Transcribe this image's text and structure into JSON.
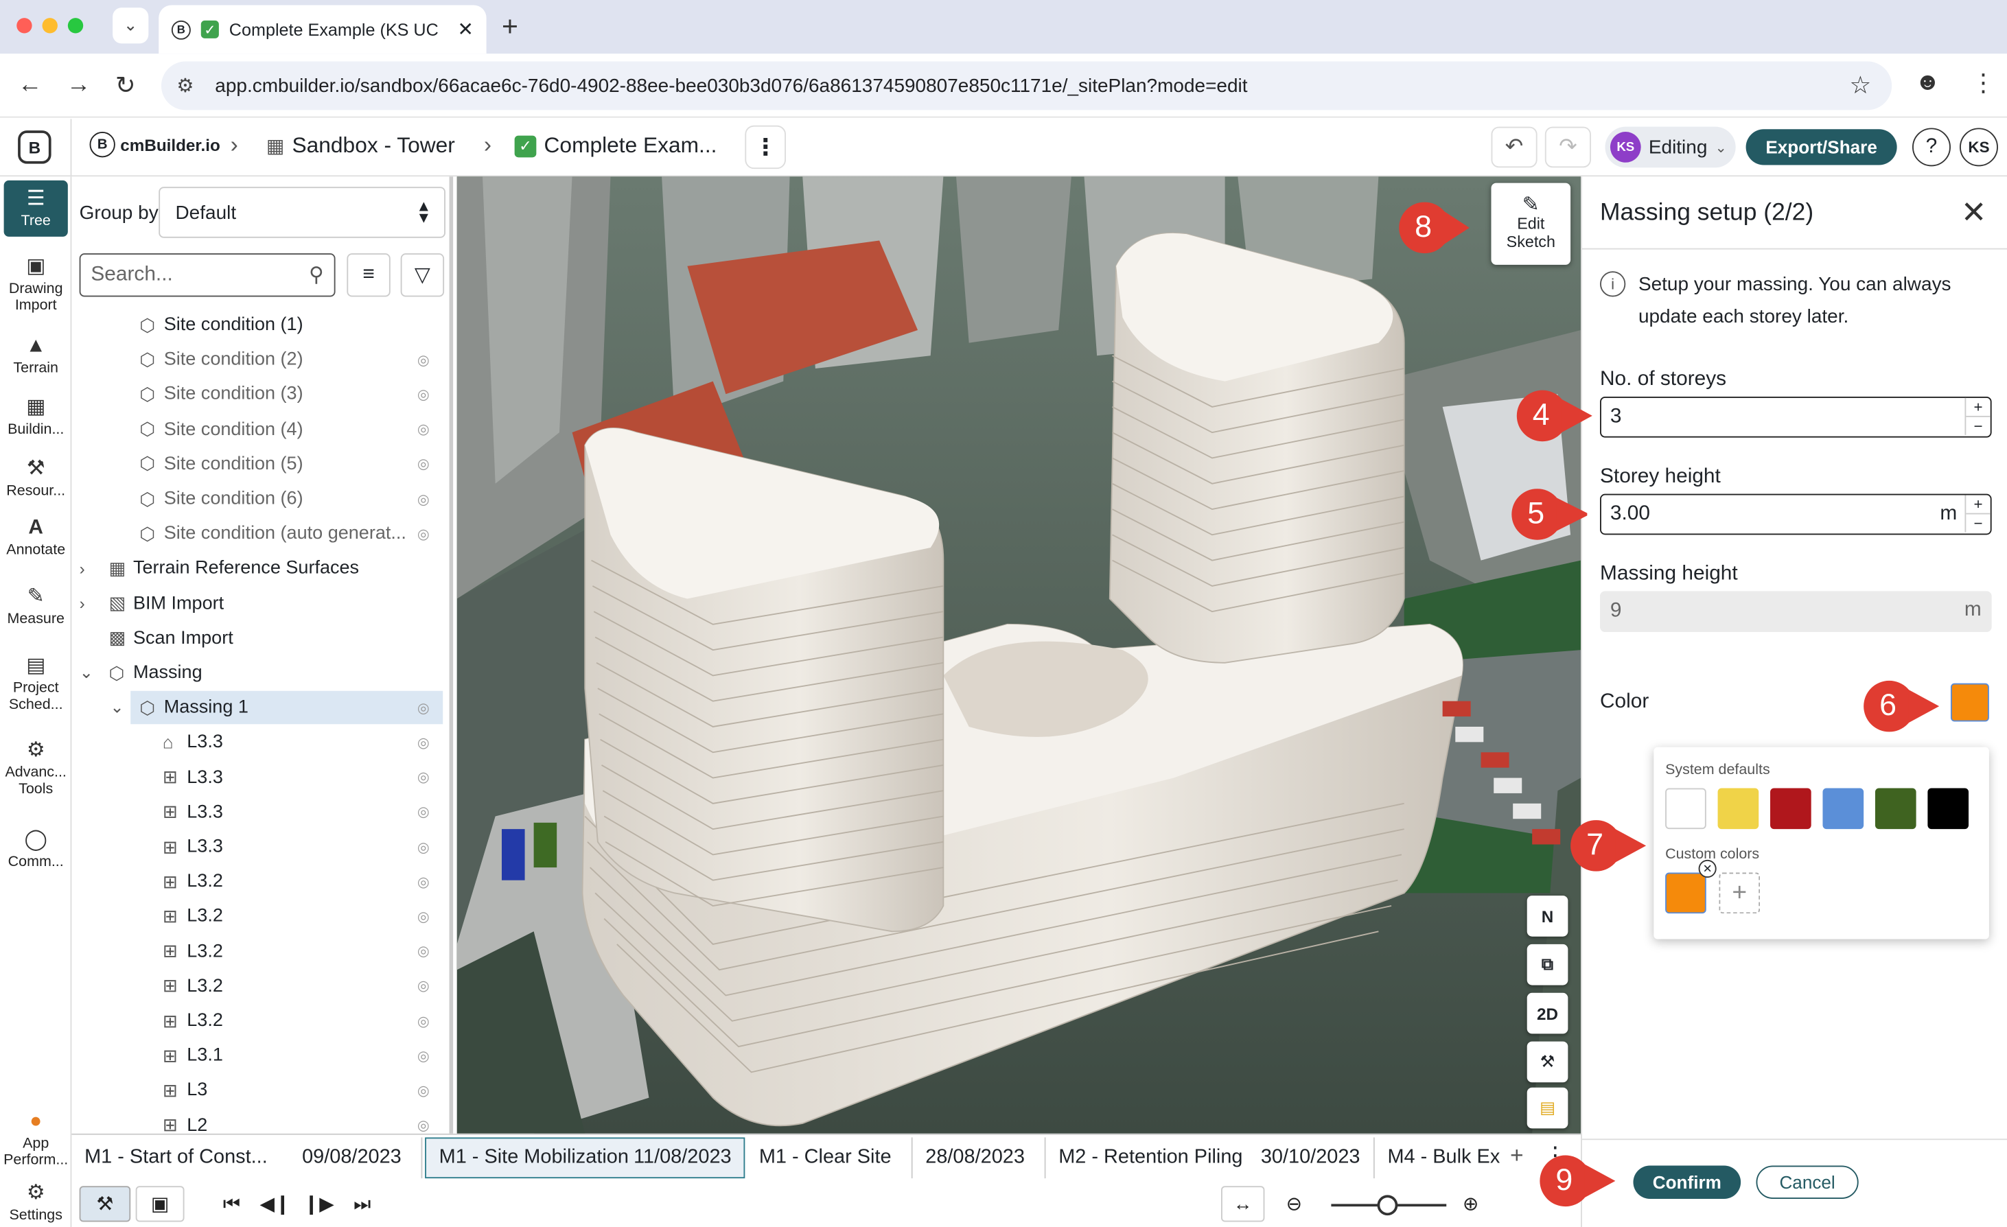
{
  "browser": {
    "tab_title": "Complete Example (KS UC",
    "url": "app.cmbuilder.io/sandbox/66acae6c-76d0-4902-88ee-bee030b3d076/6a861374590807e850c1171e/_sitePlan?mode=edit"
  },
  "header": {
    "brand": "cmBuilder.io",
    "crumb_project": "Sandbox - Tower",
    "crumb_file": "Complete Exam...",
    "status": "Editing",
    "user_initials": "KS",
    "export_label": "Export/Share",
    "help": "?"
  },
  "left_toolbar": [
    {
      "label": "Tree",
      "icon": "tree-icon",
      "active": true
    },
    {
      "label": "Drawing Import",
      "icon": "image-icon"
    },
    {
      "label": "Terrain",
      "icon": "terrain-icon"
    },
    {
      "label": "Buildin...",
      "icon": "building-icon"
    },
    {
      "label": "Resour...",
      "icon": "resources-icon"
    },
    {
      "label": "Annotate",
      "icon": "annotate-icon"
    },
    {
      "label": "Measure",
      "icon": "measure-icon"
    },
    {
      "label": "Project Sched...",
      "icon": "schedule-icon"
    },
    {
      "label": "Advanc... Tools",
      "icon": "advanced-tools-icon"
    },
    {
      "label": "Comm...",
      "icon": "comment-icon"
    },
    {
      "label": "App Perform...",
      "icon": "performance-icon"
    },
    {
      "label": "Settings",
      "icon": "settings-icon"
    }
  ],
  "tree": {
    "group_by_label": "Group by",
    "group_by_value": "Default",
    "search_placeholder": "Search...",
    "items": [
      {
        "label": "Site condition (1)",
        "level": 1,
        "visible": true
      },
      {
        "label": "Site condition (2)",
        "level": 1,
        "visible": false
      },
      {
        "label": "Site condition (3)",
        "level": 1,
        "visible": false
      },
      {
        "label": "Site condition (4)",
        "level": 1,
        "visible": false
      },
      {
        "label": "Site condition (5)",
        "level": 1,
        "visible": false
      },
      {
        "label": "Site condition (6)",
        "level": 1,
        "visible": false
      },
      {
        "label": "Site condition (auto generat...",
        "level": 1,
        "visible": false
      },
      {
        "label": "Terrain Reference Surfaces",
        "level": 0,
        "visible": false
      },
      {
        "label": "BIM Import",
        "level": 0,
        "visible": false
      },
      {
        "label": "Scan Import",
        "level": 0,
        "visible": true
      },
      {
        "label": "Massing",
        "level": 0,
        "visible": true
      },
      {
        "label": "Massing 1",
        "level": 1,
        "visible": true,
        "selected": true
      },
      {
        "label": "L3.3",
        "level": 2,
        "visible": true
      },
      {
        "label": "L3.3",
        "level": 2,
        "visible": true
      },
      {
        "label": "L3.3",
        "level": 2,
        "visible": true
      },
      {
        "label": "L3.3",
        "level": 2,
        "visible": true
      },
      {
        "label": "L3.2",
        "level": 2,
        "visible": true
      },
      {
        "label": "L3.2",
        "level": 2,
        "visible": true
      },
      {
        "label": "L3.2",
        "level": 2,
        "visible": true
      },
      {
        "label": "L3.2",
        "level": 2,
        "visible": true
      },
      {
        "label": "L3.2",
        "level": 2,
        "visible": true
      },
      {
        "label": "L3.1",
        "level": 2,
        "visible": true
      },
      {
        "label": "L3",
        "level": 2,
        "visible": true
      },
      {
        "label": "L2",
        "level": 2,
        "visible": true
      }
    ]
  },
  "viewport": {
    "edit_sketch": "Edit Sketch",
    "view_buttons": [
      "N",
      "⧉",
      "2D",
      "⚒",
      "▤"
    ]
  },
  "massing_panel": {
    "title": "Massing setup (2/2)",
    "info": "Setup your massing. You can always update each storey later.",
    "storeys_label": "No. of storeys",
    "storeys_value": "3",
    "storey_height_label": "Storey height",
    "storey_height_value": "3.00",
    "storey_height_unit": "m",
    "massing_height_label": "Massing height",
    "massing_height_value": "9",
    "massing_height_unit": "m",
    "color_label": "Color",
    "selected_color": "#f58a0b",
    "system_defaults_label": "System defaults",
    "system_colors": [
      "#ffffff",
      "#f0d348",
      "#b0171c",
      "#5b8fd8",
      "#3f6320",
      "#000000"
    ],
    "custom_colors_label": "Custom colors",
    "custom_colors": [
      "#f58a0b"
    ],
    "confirm_label": "Confirm",
    "cancel_label": "Cancel"
  },
  "timeline": [
    {
      "name": "M1 - Start of Const...",
      "date": "09/08/2023"
    },
    {
      "name": "M1 - Site Mobilization",
      "date": "11/08/2023",
      "active": true
    },
    {
      "name": "M1 - Clear Site",
      "date": ""
    },
    {
      "name": "",
      "date": "28/08/2023"
    },
    {
      "name": "M2 - Retention Piling",
      "date": "30/10/2023"
    },
    {
      "name": "M4 - Bulk Ex",
      "date": ""
    }
  ],
  "callouts": [
    "8",
    "4",
    "5",
    "6",
    "7",
    "9"
  ],
  "colors": {
    "accent": "#245a63",
    "callout": "#e03c31"
  }
}
